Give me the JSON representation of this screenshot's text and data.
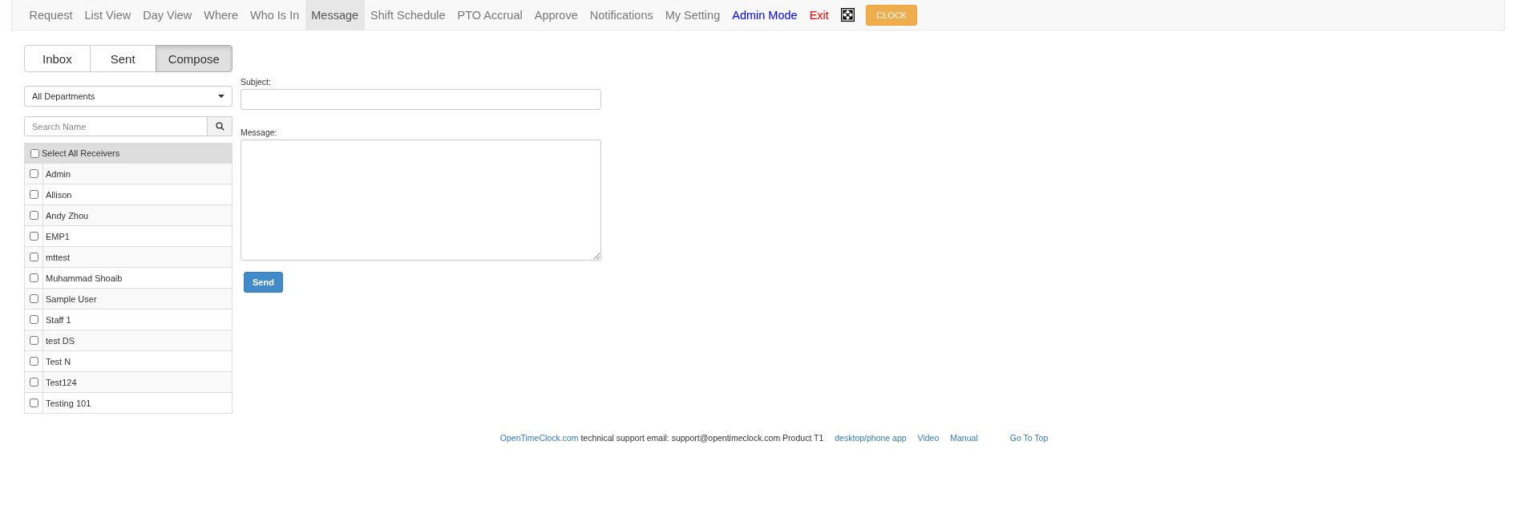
{
  "nav": {
    "items": [
      {
        "label": "Request",
        "kind": "link",
        "selected": false
      },
      {
        "label": "List View",
        "kind": "link",
        "selected": false
      },
      {
        "label": "Day View",
        "kind": "link",
        "selected": false
      },
      {
        "label": "Where",
        "kind": "link",
        "selected": false
      },
      {
        "label": "Who Is In",
        "kind": "link",
        "selected": false
      },
      {
        "label": "Message",
        "kind": "link",
        "selected": true
      },
      {
        "label": "Shift Schedule",
        "kind": "link",
        "selected": false
      },
      {
        "label": "PTO Accrual",
        "kind": "link",
        "selected": false
      },
      {
        "label": "Approve",
        "kind": "link",
        "selected": false
      },
      {
        "label": "Notifications",
        "kind": "link",
        "selected": false
      },
      {
        "label": "My Setting",
        "kind": "link",
        "selected": false
      },
      {
        "label": "Admin Mode",
        "kind": "admin",
        "selected": false
      },
      {
        "label": "Exit",
        "kind": "exit",
        "selected": false
      },
      {
        "kind": "fullscreen",
        "selected": false
      },
      {
        "label": "CLOCK",
        "kind": "clock",
        "selected": false
      }
    ]
  },
  "tabs": [
    {
      "label": "Inbox",
      "selected": false
    },
    {
      "label": "Sent",
      "selected": false
    },
    {
      "label": "Compose",
      "selected": true
    }
  ],
  "department_select": {
    "value": "All Departments"
  },
  "search": {
    "placeholder": "Search Name"
  },
  "receivers": {
    "select_all": {
      "label": "Select All Receivers",
      "checked": false
    },
    "rows": [
      {
        "name": "Admin",
        "checked": false
      },
      {
        "name": "Allison",
        "checked": false
      },
      {
        "name": "Andy Zhou",
        "checked": false
      },
      {
        "name": "EMP1",
        "checked": false
      },
      {
        "name": "mttest",
        "checked": false
      },
      {
        "name": "Muhammad Shoaib",
        "checked": false
      },
      {
        "name": "Sample User",
        "checked": false
      },
      {
        "name": "Staff 1",
        "checked": false
      },
      {
        "name": "test DS",
        "checked": false
      },
      {
        "name": "Test N",
        "checked": false
      },
      {
        "name": "Test124",
        "checked": false
      },
      {
        "name": "Testing 101",
        "checked": false
      }
    ]
  },
  "compose": {
    "subject_label": "Subject:",
    "message_label": "Message:",
    "send": "Send"
  },
  "footer": {
    "items": [
      {
        "text": "OpenTimeClock.com",
        "kind": "link"
      },
      {
        "text": "technical support email: support@opentimeclock.com Product T1",
        "kind": "text"
      },
      {
        "text": "desktop/phone app",
        "kind": "link"
      },
      {
        "text": "Video",
        "kind": "link"
      },
      {
        "text": "Manual",
        "kind": "link"
      },
      {
        "text": "Go To Top",
        "kind": "top"
      }
    ]
  }
}
